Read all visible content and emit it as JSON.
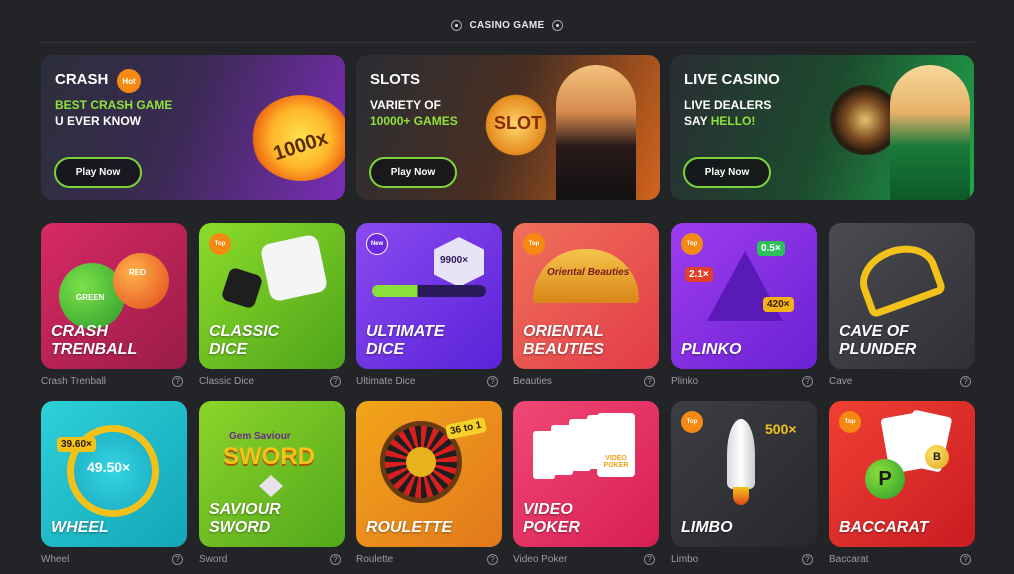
{
  "section": {
    "title": "CASINO GAME"
  },
  "banners": [
    {
      "title": "CRASH",
      "badge": "Hot",
      "line1": "BEST CRASH GAME",
      "line2": "U EVER KNOW",
      "art_text": "1000x",
      "button": "Play Now"
    },
    {
      "title": "SLOTS",
      "line1": "VARIETY OF",
      "line2": "10000+ GAMES",
      "art_text": "SLOT",
      "button": "Play Now"
    },
    {
      "title": "LIVE CASINO",
      "line1": "LIVE DEALERS",
      "line2a": "SAY ",
      "line2b": "HELLO!",
      "button": "Play Now"
    }
  ],
  "games": [
    {
      "name1": "CRASH",
      "name2": "TRENBALL",
      "caption": "Crash Trenball",
      "art1": "RED",
      "art2": "GREEN"
    },
    {
      "name1": "CLASSIC",
      "name2": "DICE",
      "caption": "Classic Dice",
      "badge": "Top"
    },
    {
      "name1": "ULTIMATE",
      "name2": "DICE",
      "caption": "Ultimate Dice",
      "badge": "New",
      "art1": "9900×"
    },
    {
      "name1": "ORIENTAL",
      "name2": "BEAUTIES",
      "caption": "Beauties",
      "badge": "Top",
      "art1": "Oriental Beauties"
    },
    {
      "name1": "PLINKO",
      "name2": "",
      "caption": "Plinko",
      "badge": "Top",
      "art1": "0.5×",
      "art2": "2.1×",
      "art3": "420×"
    },
    {
      "name1": "CAVE OF",
      "name2": "PLUNDER",
      "caption": "Cave"
    },
    {
      "name1": "WHEEL",
      "name2": "",
      "caption": "Wheel",
      "art1": "39.60×",
      "art2": "49.50×"
    },
    {
      "name1": "SAVIOUR",
      "name2": "SWORD",
      "caption": "Sword",
      "art1": "Gem Saviour",
      "art2": "SWORD"
    },
    {
      "name1": "ROULETTE",
      "name2": "",
      "caption": "Roulette",
      "art1": "36 to 1"
    },
    {
      "name1": "VIDEO",
      "name2": "POKER",
      "caption": "Video Poker",
      "art1": "VIDEO POKER"
    },
    {
      "name1": "LIMBO",
      "name2": "",
      "caption": "Limbo",
      "badge": "Top",
      "art1": "500×"
    },
    {
      "name1": "BACCARAT",
      "name2": "",
      "caption": "Baccarat",
      "badge": "Top",
      "art1": "P",
      "art2": "B"
    }
  ],
  "colors": {
    "accent_green": "#7cd33a",
    "hot_orange": "#f58a12",
    "background": "#232428"
  },
  "icons": {
    "help": "question-circle-icon"
  }
}
